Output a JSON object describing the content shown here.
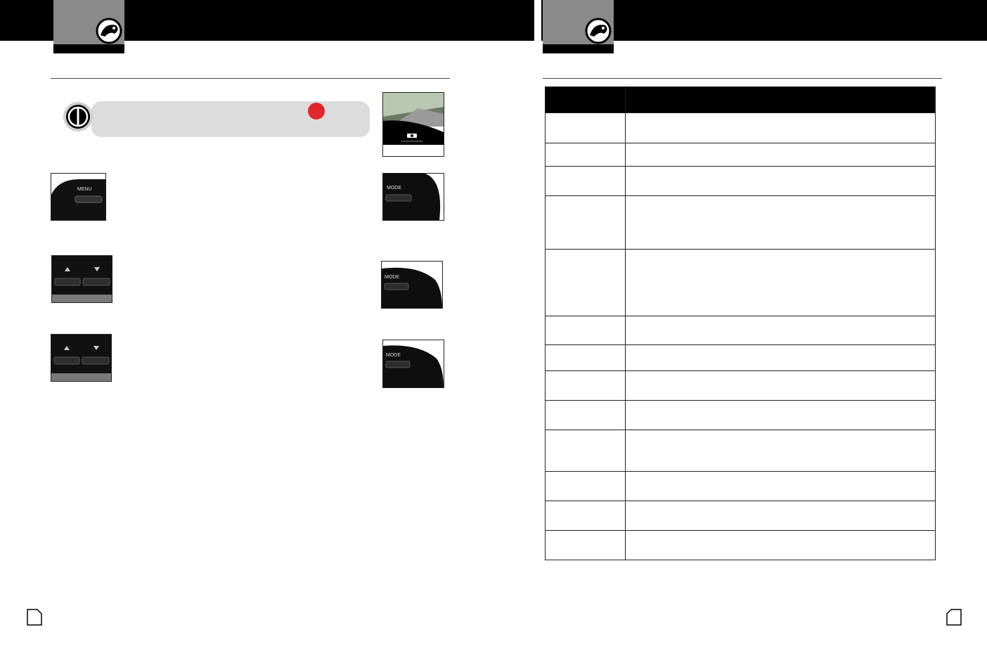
{
  "left_page": {
    "header": {
      "logo_icon": "cobra-snake-logo-icon"
    },
    "callout": {
      "icon": "warning-icon",
      "indicator_color": "#e1262c"
    },
    "button_images": [
      {
        "name": "screenshot-button-photo",
        "label": ""
      },
      {
        "name": "menu-button-photo",
        "label": "MENU"
      },
      {
        "name": "mode-button-photo-1",
        "label": "MODE"
      },
      {
        "name": "arrow-buttons-photo-1",
        "label": ""
      },
      {
        "name": "mode-button-photo-2",
        "label": "MODE"
      },
      {
        "name": "arrow-buttons-photo-2",
        "label": ""
      },
      {
        "name": "mode-button-photo-3",
        "label": "MODE"
      }
    ],
    "page_number": ""
  },
  "right_page": {
    "header": {
      "logo_icon": "cobra-snake-logo-icon"
    },
    "table": {
      "header": [
        "",
        ""
      ],
      "rows": [
        [
          "",
          ""
        ],
        [
          "",
          ""
        ],
        [
          "",
          ""
        ],
        [
          "",
          ""
        ],
        [
          "",
          ""
        ],
        [
          "",
          ""
        ],
        [
          "",
          ""
        ],
        [
          "",
          ""
        ],
        [
          "",
          ""
        ],
        [
          "",
          ""
        ],
        [
          "",
          ""
        ],
        [
          "",
          ""
        ],
        [
          "",
          ""
        ]
      ]
    },
    "page_number": ""
  },
  "colors": {
    "header_bar": "#000000",
    "tab": "#8a8a8a",
    "callout": "#dcdcdc",
    "accent_red": "#e1262c"
  }
}
